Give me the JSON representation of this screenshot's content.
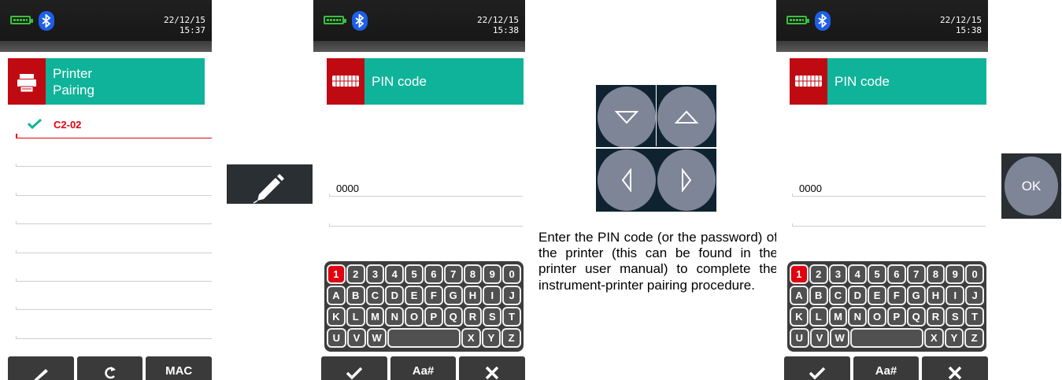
{
  "screen1": {
    "status": {
      "date": "22/12/15",
      "time": "15:37"
    },
    "header": {
      "icon": "printer-icon",
      "title_line1": "Printer",
      "title_line2": "Pairing"
    },
    "devices": [
      {
        "name": "C2-02",
        "selected": true
      }
    ],
    "toolbar": {
      "edit_icon": "pencil-icon",
      "refresh_icon": "refresh-icon",
      "mac_label": "MAC"
    }
  },
  "edit_button": {
    "icon": "pencil-icon"
  },
  "screen2": {
    "status": {
      "date": "22/12/15",
      "time": "15:38"
    },
    "header": {
      "icon": "keyboard-icon",
      "title": "PIN code"
    },
    "pin_value": "0000",
    "toolbar": {
      "confirm_icon": "check-icon",
      "case_label": "Aa#",
      "cancel_icon": "close-icon"
    }
  },
  "keyboard": {
    "rows": [
      [
        "1",
        "2",
        "3",
        "4",
        "5",
        "6",
        "7",
        "8",
        "9",
        "0"
      ],
      [
        "A",
        "B",
        "C",
        "D",
        "E",
        "F",
        "G",
        "H",
        "I",
        "J"
      ],
      [
        "K",
        "L",
        "M",
        "N",
        "O",
        "P",
        "Q",
        "R",
        "S",
        "T"
      ],
      [
        "U",
        "V",
        "W",
        " ",
        "X",
        "Y",
        "Z"
      ]
    ],
    "highlighted": "1"
  },
  "arrow_keys": [
    "down-arrow-icon",
    "up-arrow-icon",
    "left-arrow-icon",
    "right-arrow-icon"
  ],
  "description": "Enter the PIN code (or the password) of the printer (this can be found in the printer user manual) to complete the instrument-printer pairing procedure.",
  "screen3": {
    "status": {
      "date": "22/12/15",
      "time": "15:38"
    },
    "header": {
      "icon": "keyboard-icon",
      "title": "PIN code"
    },
    "pin_value": "0000",
    "toolbar": {
      "confirm_icon": "check-icon",
      "case_label": "Aa#",
      "cancel_icon": "close-icon"
    }
  },
  "ok_button": {
    "label": "OK"
  },
  "colors": {
    "header": "#0fb39a",
    "accent_red": "#c00a12",
    "selection_red": "#e0000f",
    "button_gray": "#7e8597"
  }
}
